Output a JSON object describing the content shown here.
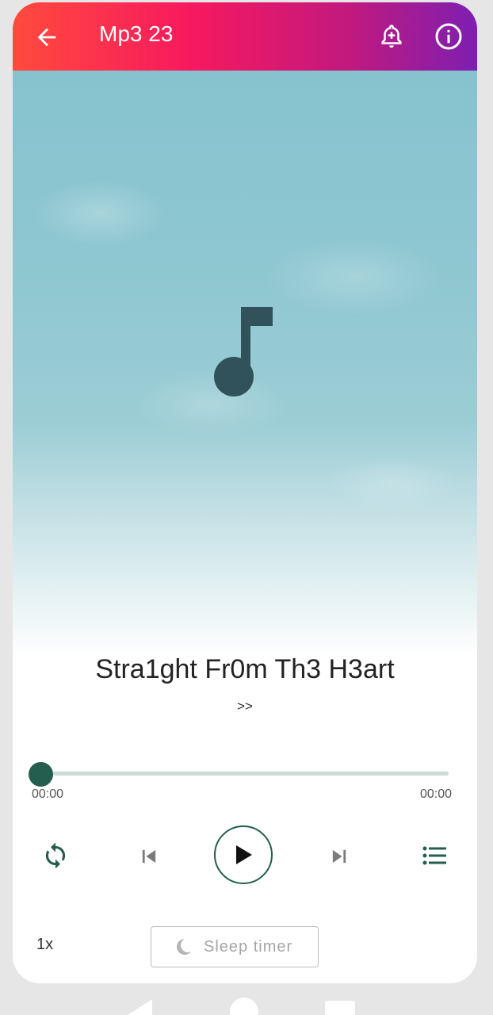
{
  "app_bar": {
    "title": "Mp3 23",
    "back_icon": "arrow-left-icon",
    "bell_icon": "bell-plus-icon",
    "info_icon": "info-icon",
    "gradient": [
      "#ff4a3d",
      "#f7195e",
      "#c2197e",
      "#7d1fb1"
    ]
  },
  "artwork": {
    "icon": "music-note-icon"
  },
  "track": {
    "title": "Stra1ght Fr0m Th3 H3art",
    "subtitle": ">>"
  },
  "seek": {
    "progress": 0,
    "elapsed": "00:00",
    "duration": "00:00",
    "accent": "#235e4f"
  },
  "controls": {
    "repeat_icon": "repeat-icon",
    "previous_icon": "skip-previous-icon",
    "play_icon": "play-icon",
    "next_icon": "skip-next-icon",
    "queue_icon": "playlist-icon"
  },
  "bottom": {
    "speed": "1x",
    "sleep_timer": "Sleep timer",
    "moon_icon": "moon-icon"
  },
  "system_nav": {
    "back_icon": "nav-back-icon",
    "home_icon": "nav-home-icon",
    "recents_icon": "nav-recents-icon"
  }
}
